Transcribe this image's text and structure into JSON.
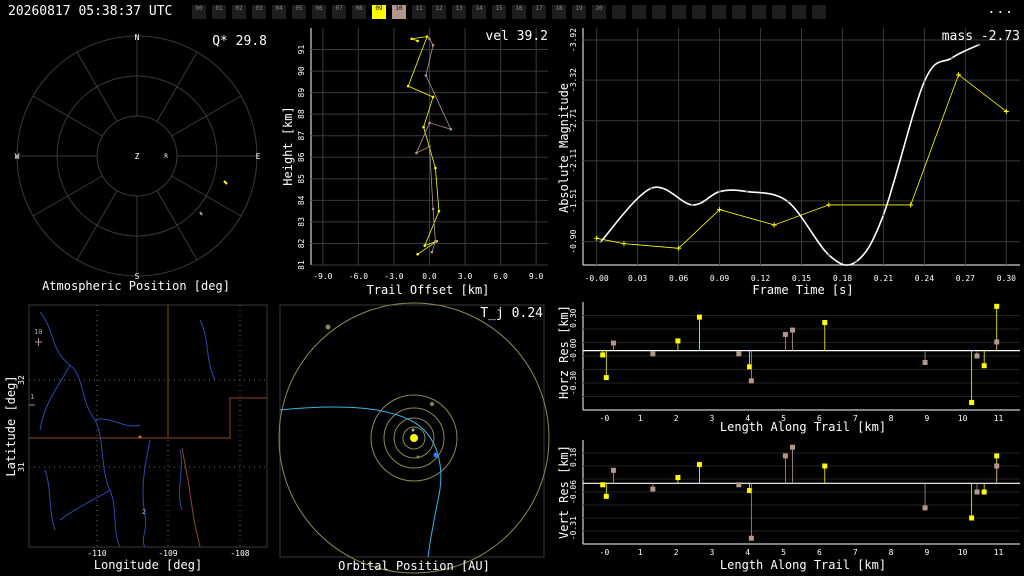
{
  "header": {
    "timestamp": "20260817 05:38:37 UTC",
    "menu_label": "...",
    "stations": [
      {
        "label": "00",
        "state": "off"
      },
      {
        "label": "01",
        "state": "off"
      },
      {
        "label": "02",
        "state": "off"
      },
      {
        "label": "03",
        "state": "off"
      },
      {
        "label": "04",
        "state": "off"
      },
      {
        "label": "05",
        "state": "off"
      },
      {
        "label": "06",
        "state": "off"
      },
      {
        "label": "07",
        "state": "off"
      },
      {
        "label": "08",
        "state": "off"
      },
      {
        "label": "09",
        "state": "yellow"
      },
      {
        "label": "10",
        "state": "tan"
      },
      {
        "label": "11",
        "state": "off"
      },
      {
        "label": "12",
        "state": "off"
      },
      {
        "label": "13",
        "state": "off"
      },
      {
        "label": "14",
        "state": "off"
      },
      {
        "label": "15",
        "state": "off"
      },
      {
        "label": "16",
        "state": "off"
      },
      {
        "label": "17",
        "state": "off"
      },
      {
        "label": "18",
        "state": "off"
      },
      {
        "label": "19",
        "state": "off"
      },
      {
        "label": "20",
        "state": "off"
      },
      {
        "label": "",
        "state": "off"
      },
      {
        "label": "",
        "state": "off"
      },
      {
        "label": "",
        "state": "off"
      },
      {
        "label": "",
        "state": "off"
      },
      {
        "label": "",
        "state": "off"
      },
      {
        "label": "",
        "state": "off"
      },
      {
        "label": "",
        "state": "off"
      },
      {
        "label": "",
        "state": "off"
      },
      {
        "label": "",
        "state": "off"
      },
      {
        "label": "",
        "state": "off"
      },
      {
        "label": "",
        "state": "off"
      }
    ]
  },
  "colors": {
    "yellow": "#ffff00",
    "tan": "#b4968c",
    "white": "#ffffff",
    "grid": "#3a3a3a",
    "blue": "#3c78ff",
    "orange": "#dc6432",
    "olive": "#8a8a50"
  },
  "panels": {
    "sky": {
      "xlabel": "Atmospheric Position [deg]",
      "value_label": "Q* 29.8",
      "compass": {
        "n": "N",
        "s": "S",
        "e": "E",
        "w": "W",
        "z": "Z",
        "r": "R"
      }
    },
    "trail": {
      "xlabel": "Trail Offset [km]",
      "ylabel": "Height [km]",
      "value_label": "vel 39.2",
      "xticks": [
        "-9.0",
        "-6.0",
        "-3.0",
        "0.0",
        "3.0",
        "6.0",
        "9.0"
      ],
      "yticks": [
        "81",
        "82",
        "83",
        "84",
        "85",
        "86",
        "87",
        "88",
        "89",
        "90",
        "91"
      ]
    },
    "mag": {
      "xlabel": "Frame Time [s]",
      "ylabel": "Absolute Magnitude",
      "value_label": "mass -2.73",
      "xticks": [
        "-0.00",
        "0.03",
        "0.06",
        "0.09",
        "0.12",
        "0.15",
        "0.18",
        "0.21",
        "0.24",
        "0.27",
        "0.30"
      ],
      "yticks": [
        "-3.92",
        "-3.32",
        "-2.71",
        "-2.11",
        "-1.51",
        "-0.90"
      ]
    },
    "map": {
      "xlabel": "Longitude [deg]",
      "ylabel": "Latitude [deg]",
      "xticks": [
        "-110",
        "-109",
        "-108"
      ],
      "yticks": [
        "32",
        "31"
      ],
      "markers": {
        "a": "10",
        "b": "1",
        "c": "2"
      }
    },
    "orbit": {
      "xlabel": "Orbital Position [AU]",
      "value_label": "T_j 0.24"
    },
    "horz": {
      "xlabel": "Length Along Trail [km]",
      "ylabel": "Horz Res [km]",
      "xticks": [
        "-0",
        "1",
        "2",
        "3",
        "4",
        "5",
        "6",
        "7",
        "8",
        "9",
        "10",
        "11"
      ],
      "yticks": [
        "0.30",
        "-0.00",
        "-0.30"
      ]
    },
    "vert": {
      "xlabel": "Length Along Trail [km]",
      "ylabel": "Vert Res [km]",
      "xticks": [
        "-0",
        "1",
        "2",
        "3",
        "4",
        "5",
        "6",
        "7",
        "8",
        "9",
        "10",
        "11"
      ],
      "yticks": [
        "0.18",
        "-0.06",
        "-0.31"
      ]
    }
  },
  "chart_data": [
    {
      "type": "line",
      "title": "",
      "xlabel": "Trail Offset [km]",
      "ylabel": "Height [km]",
      "xlim": [
        -10,
        10
      ],
      "ylim": [
        81,
        92
      ],
      "series": [
        {
          "color": "yellow",
          "x": [
            -1.0,
            -1.5,
            -0.2,
            -1.8,
            0.3,
            -0.5,
            0.5,
            0.8,
            -0.4,
            0.6,
            -1.0
          ],
          "y": [
            91.4,
            91.5,
            91.6,
            89.3,
            88.8,
            87.4,
            85.5,
            83.5,
            81.9,
            82.1,
            81.5
          ]
        },
        {
          "color": "tan",
          "x": [
            0.0,
            0.3,
            -0.3,
            1.8,
            0.0,
            -1.1,
            0.0,
            0.3,
            0.5,
            0.2
          ],
          "y": [
            91.5,
            91.2,
            89.8,
            87.3,
            87.6,
            86.2,
            86.5,
            83.6,
            82.1,
            81.6
          ]
        }
      ]
    },
    {
      "type": "line",
      "title": "",
      "xlabel": "Frame Time [s]",
      "ylabel": "Absolute Magnitude",
      "xlim": [
        -0.01,
        0.31
      ],
      "ylim": [
        -4.1,
        -0.55
      ],
      "series": [
        {
          "color": "yellow",
          "x": [
            0.0,
            0.02,
            0.06,
            0.09,
            0.13,
            0.17,
            0.23,
            0.265,
            0.3
          ],
          "y": [
            -0.95,
            -0.87,
            -0.8,
            -1.38,
            -1.15,
            -1.45,
            -1.45,
            -3.4,
            -2.85
          ]
        },
        {
          "color": "white",
          "x": [
            0.003,
            0.04,
            0.07,
            0.09,
            0.11,
            0.14,
            0.17,
            0.19,
            0.21,
            0.24,
            0.26,
            0.28
          ],
          "y": [
            -0.9,
            -1.7,
            -1.45,
            -1.65,
            -1.65,
            -1.5,
            -0.7,
            -0.6,
            -1.3,
            -3.3,
            -3.65,
            -3.85
          ]
        }
      ]
    },
    {
      "type": "scatter",
      "title": "",
      "xlabel": "Length Along Trail [km]",
      "ylabel": "Horz Res [km]",
      "xlim": [
        -0.6,
        11.6
      ],
      "ylim": [
        -0.55,
        0.45
      ],
      "series": [
        {
          "color": "yellow",
          "x": [
            -0.05,
            0.05,
            2.05,
            2.65,
            4.05,
            6.15,
            10.25,
            10.6,
            10.95
          ],
          "y": [
            -0.04,
            -0.25,
            0.09,
            0.31,
            -0.15,
            0.26,
            -0.48,
            -0.14,
            0.41
          ]
        },
        {
          "color": "tan",
          "x": [
            0.25,
            1.35,
            3.75,
            4.1,
            5.05,
            5.25,
            8.95,
            10.4,
            10.95
          ],
          "y": [
            0.07,
            -0.03,
            -0.03,
            -0.28,
            0.15,
            0.19,
            -0.11,
            -0.05,
            0.08
          ]
        }
      ]
    },
    {
      "type": "scatter",
      "title": "",
      "xlabel": "Length Along Trail [km]",
      "ylabel": "Vert Res [km]",
      "xlim": [
        -0.6,
        11.6
      ],
      "ylim": [
        -0.42,
        0.3
      ],
      "series": [
        {
          "color": "yellow",
          "x": [
            -0.05,
            0.05,
            2.05,
            2.65,
            4.05,
            6.15,
            10.25,
            10.6,
            10.95
          ],
          "y": [
            -0.01,
            -0.09,
            0.04,
            0.13,
            -0.05,
            0.12,
            -0.24,
            -0.06,
            0.19
          ]
        },
        {
          "color": "tan",
          "x": [
            0.25,
            1.35,
            3.75,
            4.1,
            5.05,
            5.25,
            8.95,
            10.4,
            10.95
          ],
          "y": [
            0.09,
            -0.04,
            -0.01,
            -0.38,
            0.19,
            0.25,
            -0.17,
            -0.06,
            0.12
          ]
        }
      ]
    }
  ]
}
